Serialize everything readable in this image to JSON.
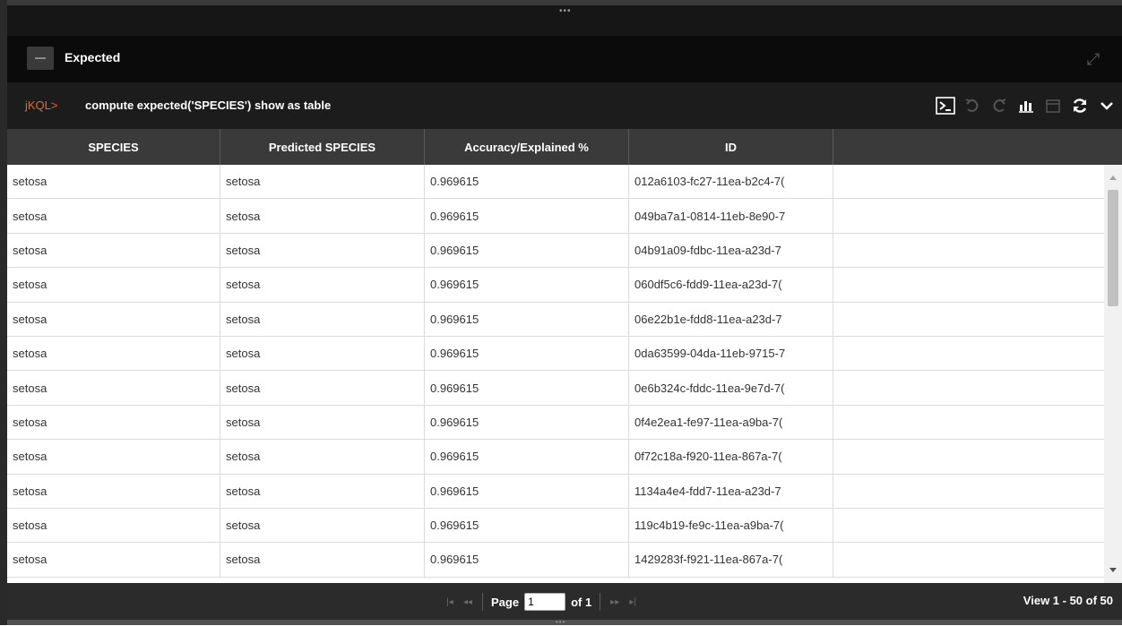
{
  "panel": {
    "title": "Expected"
  },
  "command": {
    "prompt": "jKQL>",
    "text": "compute expected('SPECIES') show as table"
  },
  "toolbar": {
    "icons": [
      "terminal-icon",
      "undo-icon",
      "redo-icon",
      "chart-icon",
      "calendar-icon",
      "refresh-icon",
      "chevron-down-icon"
    ]
  },
  "table": {
    "columns": [
      "SPECIES",
      "Predicted SPECIES",
      "Accuracy/Explained %",
      "ID"
    ],
    "rows": [
      [
        "setosa",
        "setosa",
        "0.969615",
        "012a6103-fc27-11ea-b2c4-7("
      ],
      [
        "setosa",
        "setosa",
        "0.969615",
        "049ba7a1-0814-11eb-8e90-7"
      ],
      [
        "setosa",
        "setosa",
        "0.969615",
        "04b91a09-fdbc-11ea-a23d-7"
      ],
      [
        "setosa",
        "setosa",
        "0.969615",
        "060df5c6-fdd9-11ea-a23d-7("
      ],
      [
        "setosa",
        "setosa",
        "0.969615",
        "06e22b1e-fdd8-11ea-a23d-7"
      ],
      [
        "setosa",
        "setosa",
        "0.969615",
        "0da63599-04da-11eb-9715-7"
      ],
      [
        "setosa",
        "setosa",
        "0.969615",
        "0e6b324c-fddc-11ea-9e7d-7("
      ],
      [
        "setosa",
        "setosa",
        "0.969615",
        "0f4e2ea1-fe97-11ea-a9ba-7("
      ],
      [
        "setosa",
        "setosa",
        "0.969615",
        "0f72c18a-f920-11ea-867a-7("
      ],
      [
        "setosa",
        "setosa",
        "0.969615",
        "1134a4e4-fdd7-11ea-a23d-7"
      ],
      [
        "setosa",
        "setosa",
        "0.969615",
        "119c4b19-fe9c-11ea-a9ba-7("
      ],
      [
        "setosa",
        "setosa",
        "0.969615",
        "1429283f-f921-11ea-867a-7("
      ]
    ]
  },
  "pager": {
    "page_label": "Page",
    "page_value": "1",
    "of_label": "of 1",
    "view_text": "View 1 - 50 of 50"
  },
  "colors": {
    "prompt": "#e06a2a",
    "header_bg": "#3a3a3a",
    "title_bar_bg": "#0b0b0b"
  }
}
